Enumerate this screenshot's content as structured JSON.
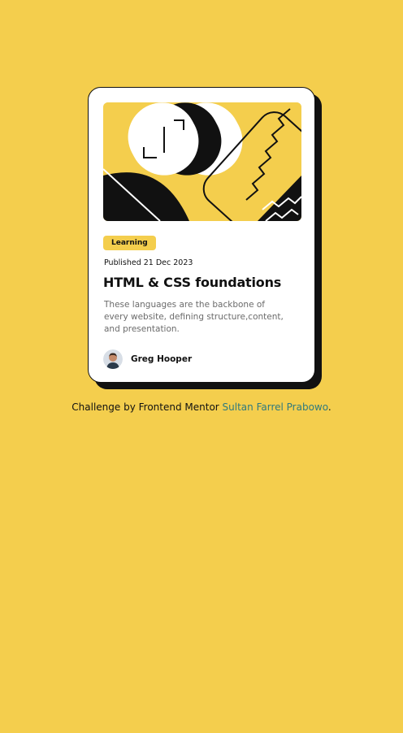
{
  "card": {
    "tag": "Learning",
    "published": "Published 21 Dec 2023",
    "title": "HTML & CSS foundations",
    "description": "These languages are the backbone of every website, defining structure,content, and presentation.",
    "author": {
      "name": "Greg Hooper"
    }
  },
  "footer": {
    "prefix": "Challenge by Frontend Mentor",
    "link_text": "Sultan Farrel Prabowo",
    "suffix": "."
  },
  "colors": {
    "background": "#F4CE4D",
    "card": "#FFFFFF",
    "ink": "#111111",
    "muted_text": "#6B6B6B",
    "link": "#2F7A7E"
  }
}
